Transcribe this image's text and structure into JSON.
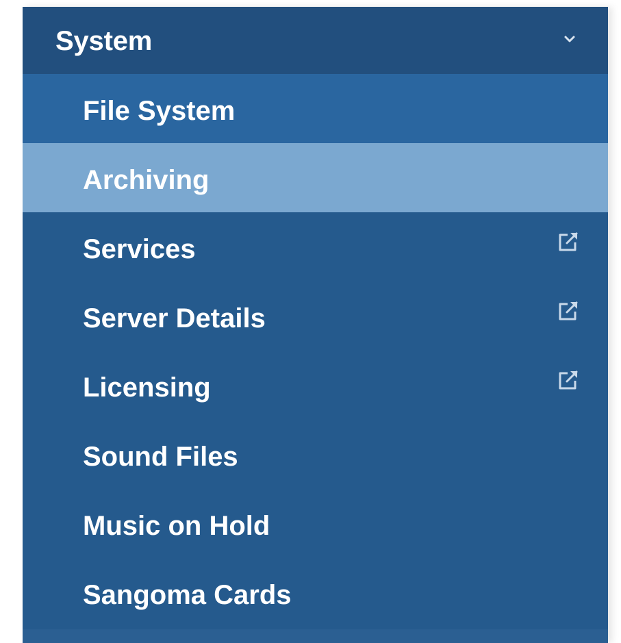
{
  "menu": {
    "title": "System",
    "expanded": true,
    "items": [
      {
        "label": "File System",
        "external": false,
        "active": false
      },
      {
        "label": "Archiving",
        "external": false,
        "active": true
      },
      {
        "label": "Services",
        "external": true,
        "active": false
      },
      {
        "label": "Server Details",
        "external": true,
        "active": false
      },
      {
        "label": "Licensing",
        "external": true,
        "active": false
      },
      {
        "label": "Sound Files",
        "external": false,
        "active": false
      },
      {
        "label": "Music on Hold",
        "external": false,
        "active": false
      },
      {
        "label": "Sangoma Cards",
        "external": false,
        "active": false
      }
    ]
  },
  "icons": {
    "collapse": "chevron-down-icon",
    "external": "external-link-icon"
  },
  "colors": {
    "menu_bg": "#255a8d",
    "header_bg": "#224f7e",
    "first_item_bg": "#2a66a0",
    "active_item_bg": "#7ba8d0",
    "text": "#ffffff",
    "icon": "#c9d9ea"
  }
}
